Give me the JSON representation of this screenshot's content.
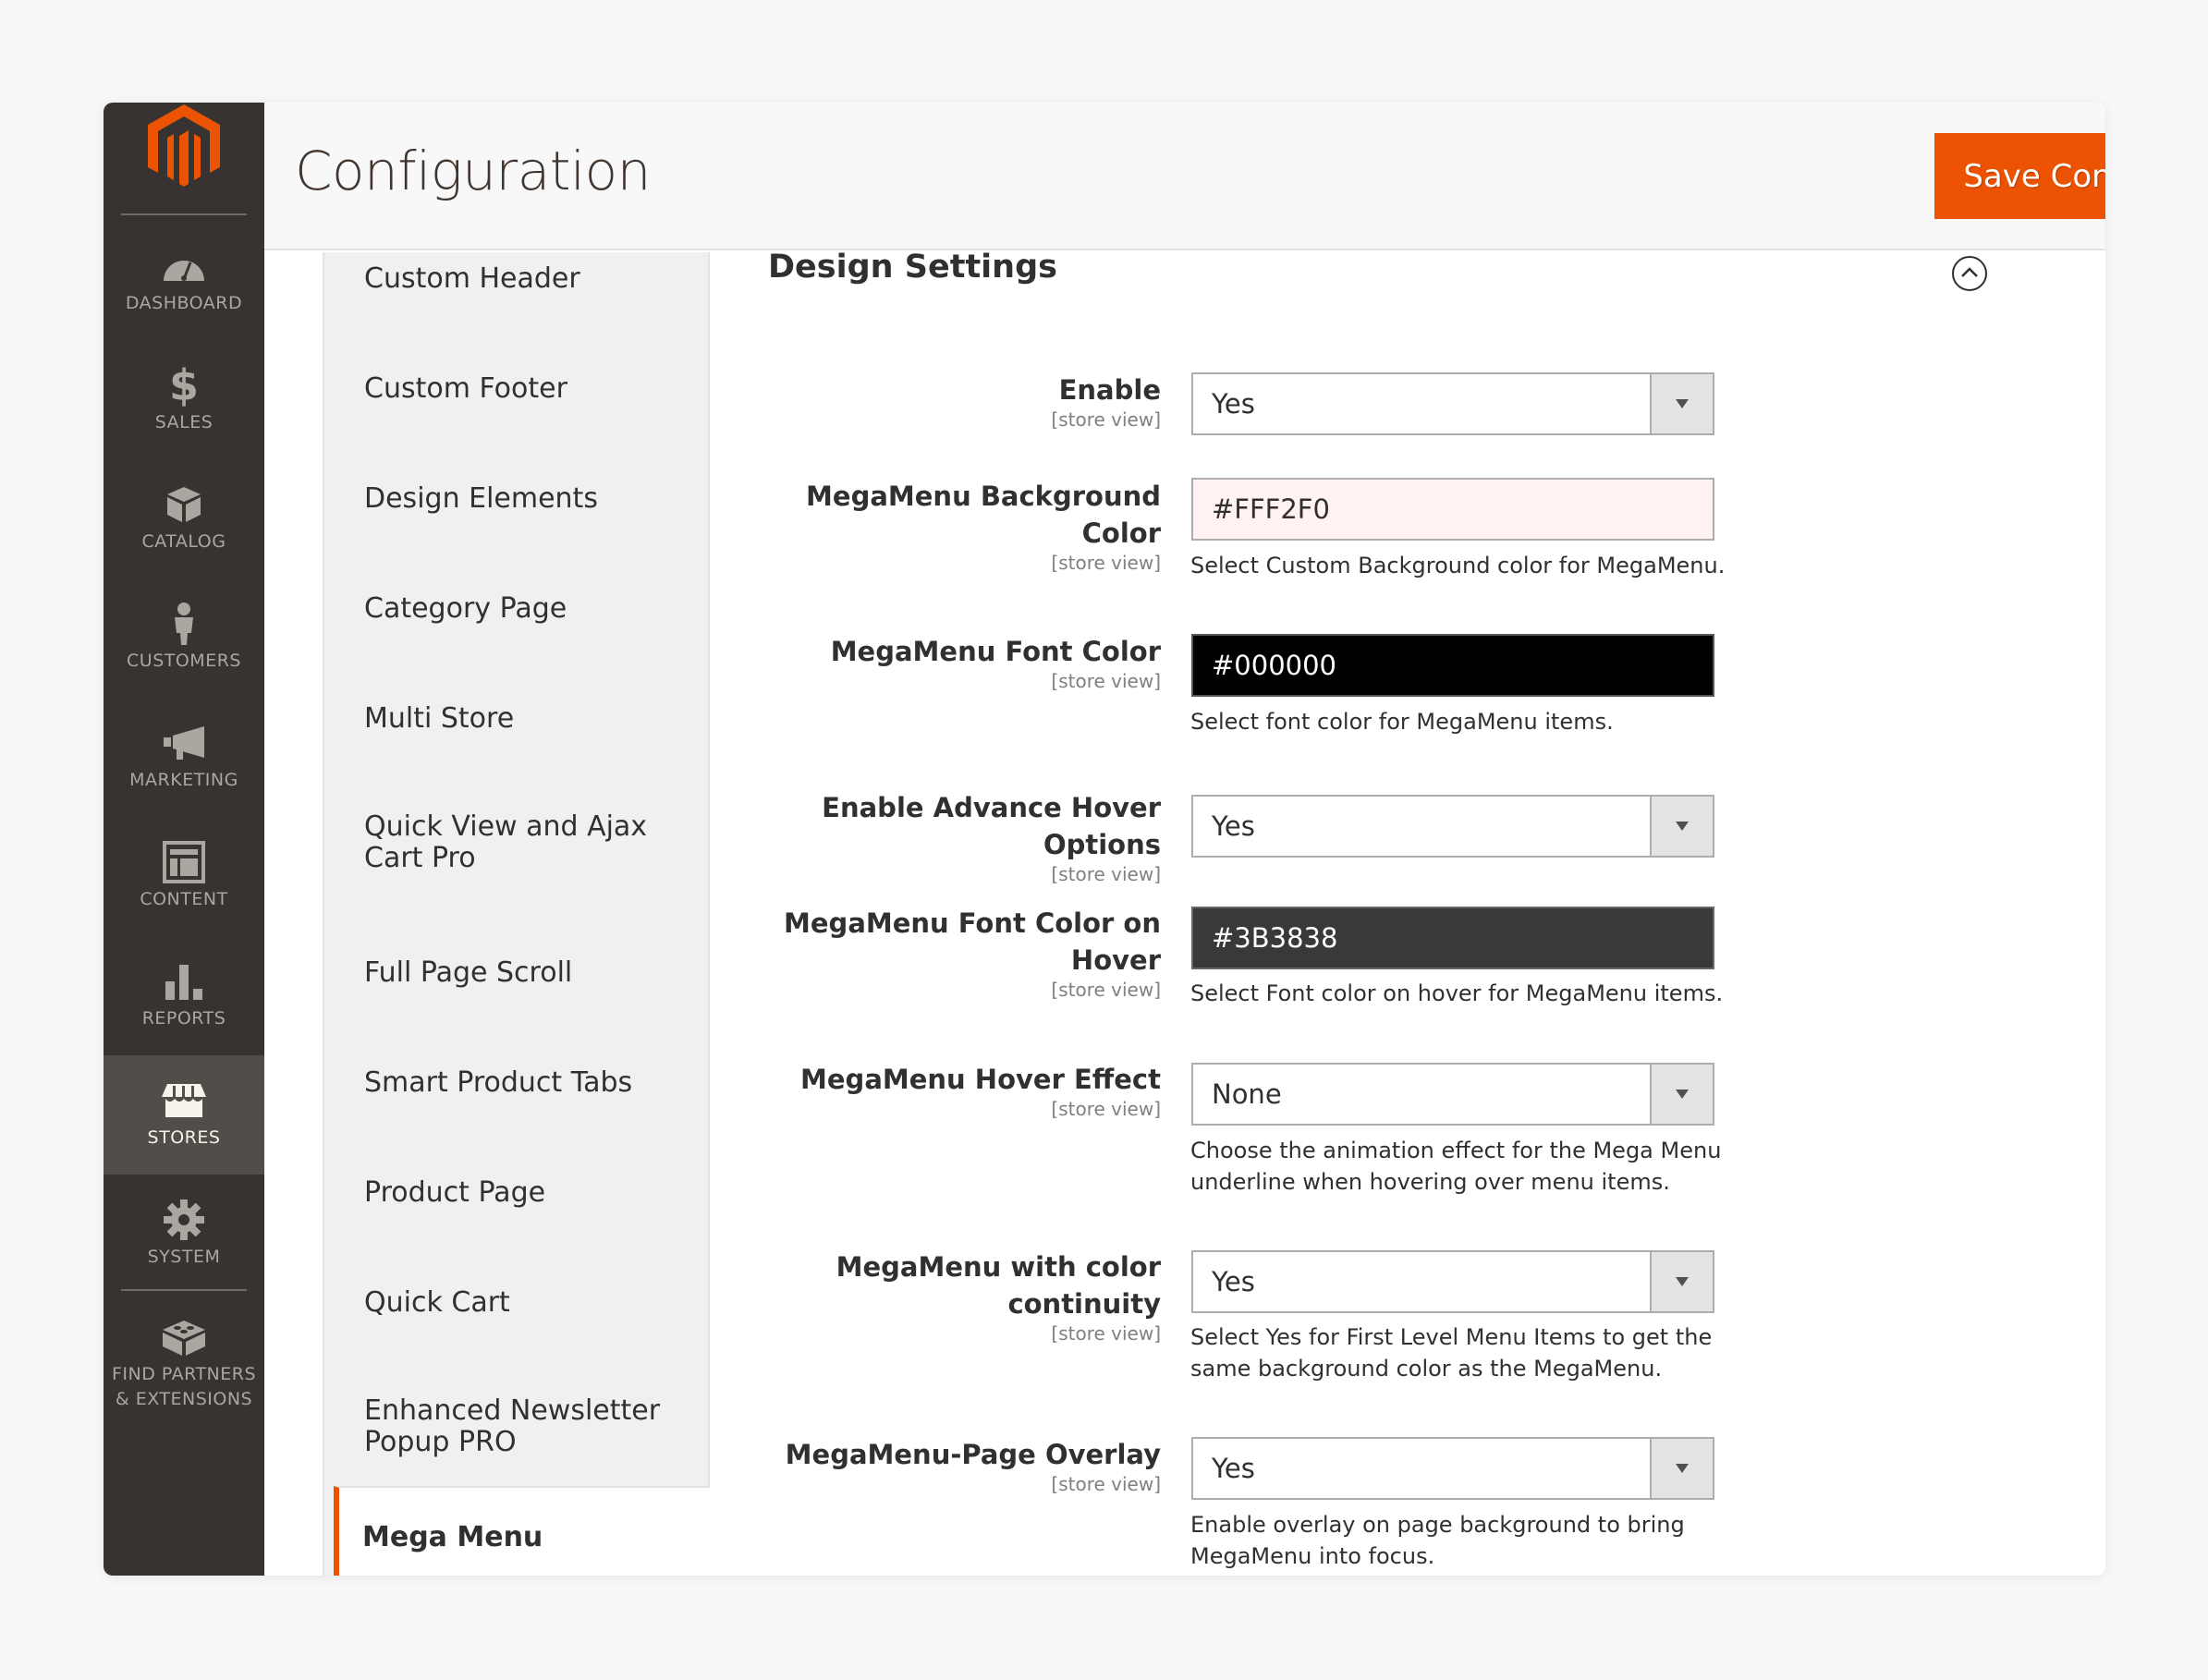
{
  "sidebar": {
    "items": [
      {
        "label": "Dashboard",
        "icon": "dashboard-icon"
      },
      {
        "label": "Sales",
        "icon": "dollar-icon"
      },
      {
        "label": "Catalog",
        "icon": "box-icon"
      },
      {
        "label": "Customers",
        "icon": "person-icon"
      },
      {
        "label": "Marketing",
        "icon": "megaphone-icon"
      },
      {
        "label": "Content",
        "icon": "layout-icon"
      },
      {
        "label": "Reports",
        "icon": "bar-chart-icon"
      },
      {
        "label": "Stores",
        "icon": "store-icon",
        "active": true
      },
      {
        "label": "System",
        "icon": "gear-icon"
      },
      {
        "label": "Find Partners & Extensions",
        "icon": "blocks-icon"
      }
    ]
  },
  "header": {
    "title": "Configuration",
    "save_label": "Save Config"
  },
  "config_nav": {
    "items": [
      "Custom Header",
      "Custom Footer",
      "Design Elements",
      "Category Page",
      "Multi Store",
      "Quick View and Ajax Cart Pro",
      "Full Page Scroll",
      "Smart Product Tabs",
      "Product Page",
      "Quick Cart",
      "Enhanced Newsletter Popup PRO"
    ],
    "active": "Mega Menu"
  },
  "section": {
    "title": "Design Settings",
    "scope": "[store view]",
    "fields": [
      {
        "label": "Enable",
        "type": "select",
        "value": "Yes",
        "note": ""
      },
      {
        "label": "MegaMenu Background Color",
        "type": "color",
        "value": "#FFF2F0",
        "bg": "#fff2f0",
        "fg": "#303030",
        "note": "Select Custom Background color for MegaMenu."
      },
      {
        "label": "MegaMenu Font Color",
        "type": "color",
        "value": "#000000",
        "bg": "#000000",
        "fg": "#ffffff",
        "note": "Select font color for MegaMenu items."
      },
      {
        "label": "Enable Advance Hover Options",
        "type": "select",
        "value": "Yes",
        "note": ""
      },
      {
        "label": "MegaMenu Font Color on Hover",
        "type": "color",
        "value": "#3B3838",
        "bg": "#3b3838",
        "fg": "#ffffff",
        "note": "Select Font color on hover for MegaMenu items."
      },
      {
        "label": "MegaMenu Hover Effect",
        "type": "select",
        "value": "None",
        "note": "Choose the animation effect for the Mega Menu underline when hovering over menu items."
      },
      {
        "label": "MegaMenu with color continuity",
        "type": "select",
        "value": "Yes",
        "note": "Select Yes for First Level Menu Items to get the same background color as the MegaMenu."
      },
      {
        "label": "MegaMenu-Page Overlay",
        "type": "select",
        "value": "Yes",
        "note": "Enable overlay on page background to bring MegaMenu into focus."
      }
    ]
  },
  "colors": {
    "accent": "#eb5202",
    "sidebar_bg": "#373330",
    "sidebar_active": "#524d49"
  }
}
